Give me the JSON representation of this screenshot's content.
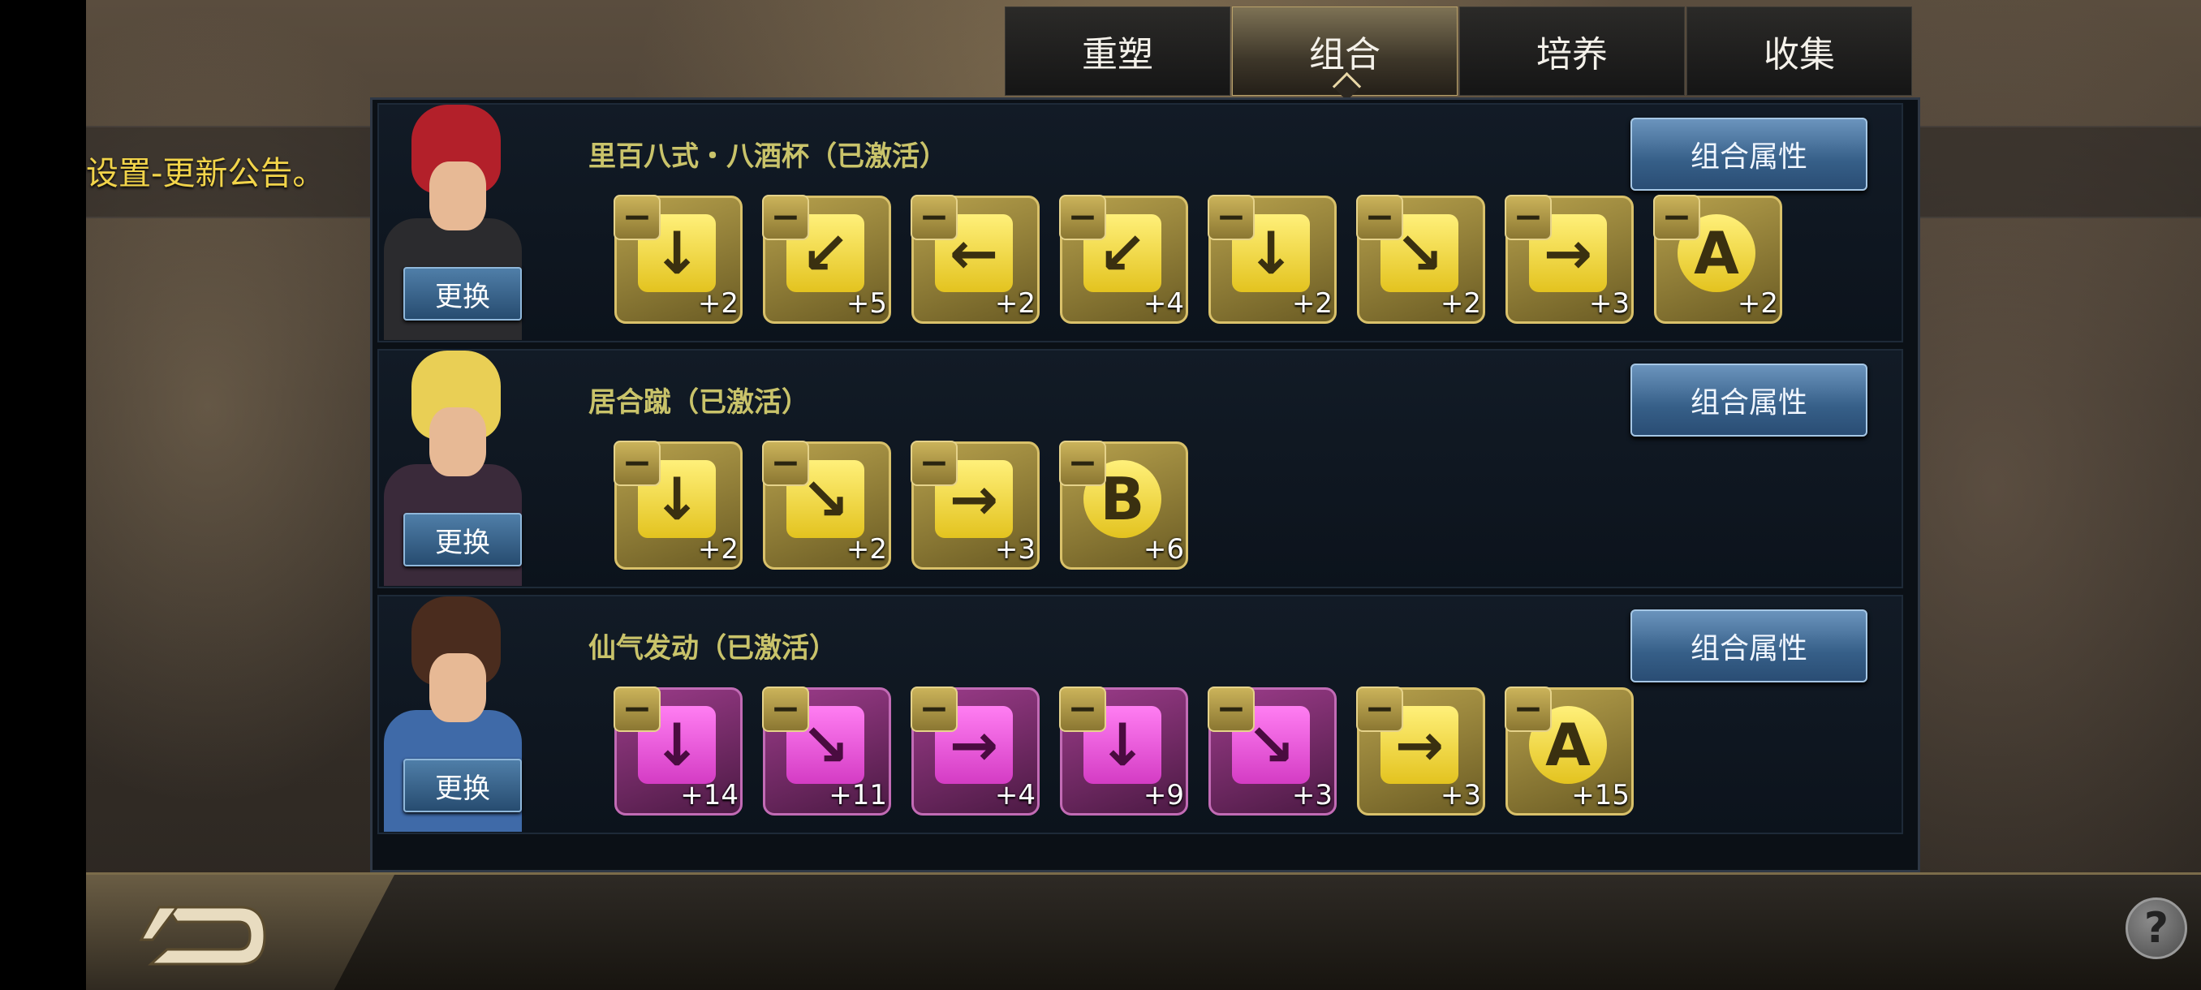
{
  "tabs": [
    {
      "label": "重塑",
      "active": false
    },
    {
      "label": "组合",
      "active": true
    },
    {
      "label": "培养",
      "active": false
    },
    {
      "label": "收集",
      "active": false
    }
  ],
  "notice": "设置-更新公告。",
  "swap_label": "更换",
  "attr_label": "组合属性",
  "minus_symbol": "−",
  "combos": [
    {
      "name": "里百八式・八酒杯（已激活）",
      "cards": [
        {
          "icon": "arrow-down-icon",
          "glyph": "↓",
          "level": "+2",
          "color": "yellow"
        },
        {
          "icon": "arrow-down-left-icon",
          "glyph": "↙",
          "level": "+5",
          "color": "yellow"
        },
        {
          "icon": "arrow-left-icon",
          "glyph": "←",
          "level": "+2",
          "color": "yellow"
        },
        {
          "icon": "arrow-down-left-icon",
          "glyph": "↙",
          "level": "+4",
          "color": "yellow"
        },
        {
          "icon": "arrow-down-icon",
          "glyph": "↓",
          "level": "+2",
          "color": "yellow"
        },
        {
          "icon": "arrow-down-right-icon",
          "glyph": "↘",
          "level": "+2",
          "color": "yellow"
        },
        {
          "icon": "arrow-right-icon",
          "glyph": "→",
          "level": "+3",
          "color": "yellow"
        },
        {
          "icon": "button-a-icon",
          "glyph": "A",
          "level": "+2",
          "color": "yellow"
        }
      ]
    },
    {
      "name": "居合蹴（已激活）",
      "cards": [
        {
          "icon": "arrow-down-icon",
          "glyph": "↓",
          "level": "+2",
          "color": "yellow"
        },
        {
          "icon": "arrow-down-right-icon",
          "glyph": "↘",
          "level": "+2",
          "color": "yellow"
        },
        {
          "icon": "arrow-right-icon",
          "glyph": "→",
          "level": "+3",
          "color": "yellow"
        },
        {
          "icon": "button-b-icon",
          "glyph": "B",
          "level": "+6",
          "color": "yellow"
        }
      ]
    },
    {
      "name": "仙气发动（已激活）",
      "cards": [
        {
          "icon": "arrow-down-icon",
          "glyph": "↓",
          "level": "+14",
          "color": "purple"
        },
        {
          "icon": "arrow-down-right-icon",
          "glyph": "↘",
          "level": "+11",
          "color": "purple"
        },
        {
          "icon": "arrow-right-icon",
          "glyph": "→",
          "level": "+4",
          "color": "purple"
        },
        {
          "icon": "arrow-down-icon",
          "glyph": "↓",
          "level": "+9",
          "color": "purple"
        },
        {
          "icon": "arrow-down-right-icon",
          "glyph": "↘",
          "level": "+3",
          "color": "purple"
        },
        {
          "icon": "arrow-right-icon",
          "glyph": "→",
          "level": "+3",
          "color": "yellow"
        },
        {
          "icon": "button-a-icon",
          "glyph": "A",
          "level": "+15",
          "color": "yellow"
        }
      ]
    }
  ],
  "portrait_colors": [
    {
      "hair": "#b3202a",
      "body": "#2b2b2e"
    },
    {
      "hair": "#e9cf55",
      "body": "#3a2a3a"
    },
    {
      "hair": "#4a2c1e",
      "body": "#3f6aa8"
    }
  ],
  "colors": {
    "accent_gold": "#c9c36a",
    "button_blue": "#365f88",
    "notice_yellow": "#f2d44a"
  }
}
